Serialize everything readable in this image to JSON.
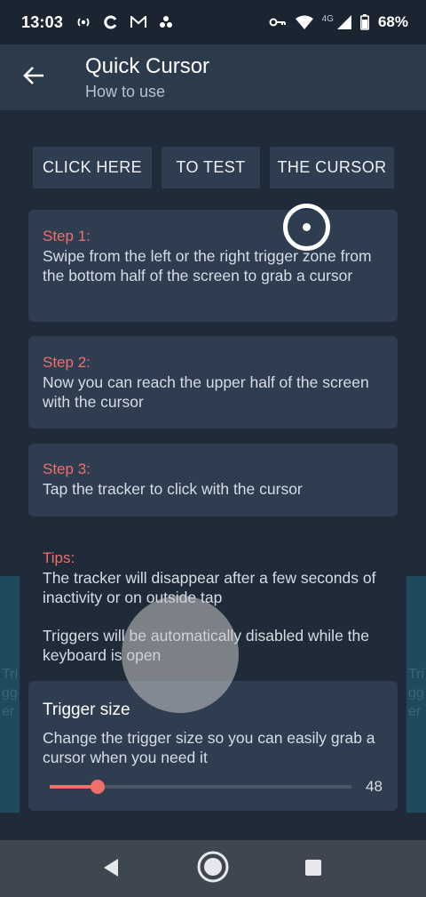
{
  "status_bar": {
    "time": "13:03",
    "network_label": "4G",
    "battery": "68%"
  },
  "app_bar": {
    "title": "Quick Cursor",
    "subtitle": "How to use"
  },
  "buttons": [
    {
      "label": "CLICK HERE"
    },
    {
      "label": "TO TEST"
    },
    {
      "label": "THE CURSOR"
    }
  ],
  "steps": [
    {
      "title": "Step 1:",
      "text": "Swipe from the left or the right trigger zone from the bottom half of the screen to grab a cursor"
    },
    {
      "title": "Step 2:",
      "text": "Now you can reach the upper half of the screen with the cursor"
    },
    {
      "title": "Step 3:",
      "text": "Tap the tracker to click with the cursor"
    }
  ],
  "tips": {
    "title": "Tips:",
    "items": [
      "The tracker will disappear after a few seconds of inactivity or on outside tap",
      "Triggers will be automatically disabled while the keyboard is open"
    ]
  },
  "trigger_zone_text": {
    "left": "Tri\ngg\ner",
    "right": "Tri\ngg\ner"
  },
  "trigger_size": {
    "title": "Trigger size",
    "description": "Change the trigger size so you can easily grab a cursor when you need it",
    "value": "48",
    "fraction": 0.16
  },
  "colors": {
    "accent": "#ef6f6a",
    "background": "#1f2b38",
    "card": "#2e3d50",
    "app_bar": "#2c3b4c"
  }
}
